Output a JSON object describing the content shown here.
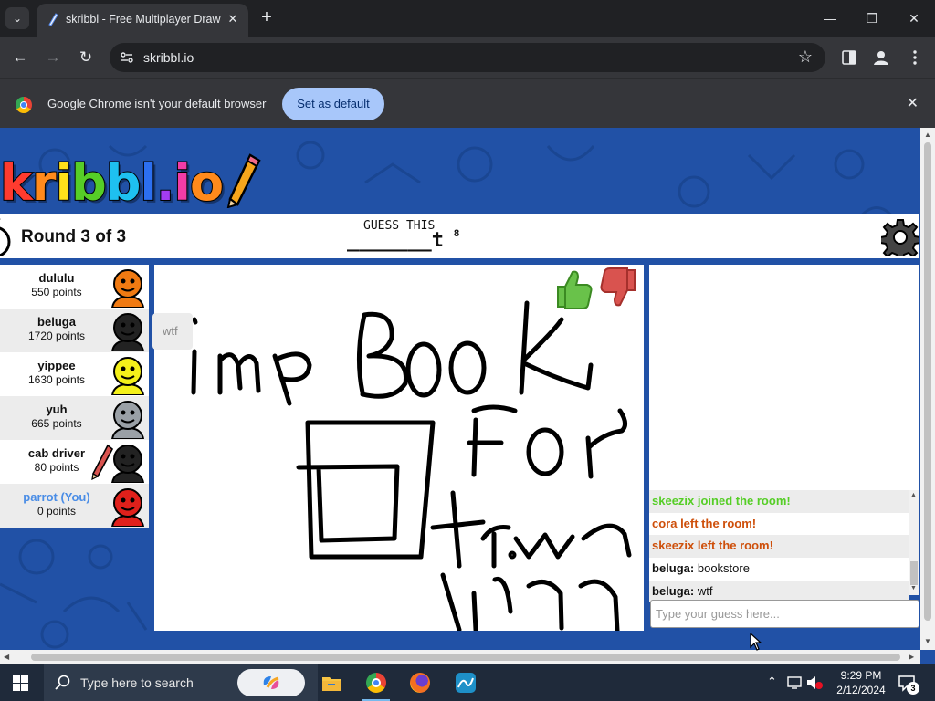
{
  "browser": {
    "tab_title": "skribbl - Free Multiplayer Drawing & Guessing Game",
    "url": "skribbl.io",
    "infobar_text": "Google Chrome isn't your default browser",
    "set_default_label": "Set as default"
  },
  "game": {
    "logo_text": "kribbl.io",
    "round_text": "Round 3 of 3",
    "guess_label": "GUESS THIS",
    "word_hint": "_______t",
    "word_length": "8",
    "bubble_text": "wtf"
  },
  "players": [
    {
      "name": "dululu",
      "points": "550 points",
      "avatar_color": "#f07a12",
      "is_you": false,
      "drawing": false
    },
    {
      "name": "beluga",
      "points": "1720 points",
      "avatar_color": "#222222",
      "is_you": false,
      "drawing": false
    },
    {
      "name": "yippee",
      "points": "1630 points",
      "avatar_color": "#f4f01a",
      "is_you": false,
      "drawing": false
    },
    {
      "name": "yuh",
      "points": "665 points",
      "avatar_color": "#9aa0a6",
      "is_you": false,
      "drawing": false
    },
    {
      "name": "cab driver",
      "points": "80 points",
      "avatar_color": "#222222",
      "is_you": false,
      "drawing": true
    },
    {
      "name": "parrot (You)",
      "points": "0 points",
      "avatar_color": "#e0201b",
      "is_you": true,
      "drawing": false
    }
  ],
  "chat": [
    {
      "type": "join",
      "text": "skeezix joined the room!"
    },
    {
      "type": "leave",
      "text": "cora left the room!"
    },
    {
      "type": "leave",
      "text": "skeezix left the room!"
    },
    {
      "type": "message",
      "author": "beluga:",
      "text": "bookstore"
    },
    {
      "type": "message",
      "author": "beluga:",
      "text": "wtf"
    }
  ],
  "chat_input_placeholder": "Type your guess here...",
  "taskbar": {
    "search_placeholder": "Type here to search",
    "time": "9:29 PM",
    "date": "2/12/2024",
    "notification_count": "3"
  },
  "colors": {
    "page_bg": "#2151a6",
    "you_name": "#4a8de6",
    "join_msg": "#56ce27",
    "leave_msg": "#ce4f0a",
    "set_default_btn": "#a8c7fa"
  }
}
